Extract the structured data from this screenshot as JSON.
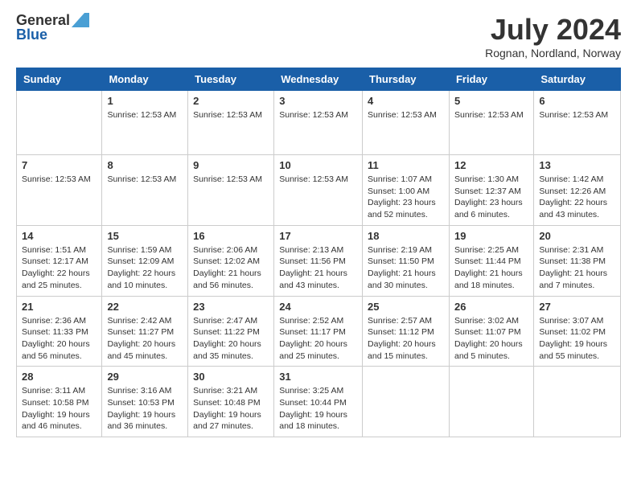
{
  "logo": {
    "general": "General",
    "blue": "Blue"
  },
  "title": "July 2024",
  "subtitle": "Rognan, Nordland, Norway",
  "headers": [
    "Sunday",
    "Monday",
    "Tuesday",
    "Wednesday",
    "Thursday",
    "Friday",
    "Saturday"
  ],
  "weeks": [
    [
      {
        "day": "",
        "info": ""
      },
      {
        "day": "1",
        "info": "Sunrise: 12:53 AM"
      },
      {
        "day": "2",
        "info": "Sunrise: 12:53 AM"
      },
      {
        "day": "3",
        "info": "Sunrise: 12:53 AM"
      },
      {
        "day": "4",
        "info": "Sunrise: 12:53 AM"
      },
      {
        "day": "5",
        "info": "Sunrise: 12:53 AM"
      },
      {
        "day": "6",
        "info": "Sunrise: 12:53 AM"
      }
    ],
    [
      {
        "day": "7",
        "info": "Sunrise: 12:53 AM"
      },
      {
        "day": "8",
        "info": "Sunrise: 12:53 AM"
      },
      {
        "day": "9",
        "info": "Sunrise: 12:53 AM"
      },
      {
        "day": "10",
        "info": "Sunrise: 12:53 AM"
      },
      {
        "day": "11",
        "info": "Sunrise: 1:07 AM\nSunset: 1:00 AM\nDaylight: 23 hours and 52 minutes."
      },
      {
        "day": "12",
        "info": "Sunrise: 1:30 AM\nSunset: 12:37 AM\nDaylight: 23 hours and 6 minutes."
      },
      {
        "day": "13",
        "info": "Sunrise: 1:42 AM\nSunset: 12:26 AM\nDaylight: 22 hours and 43 minutes."
      }
    ],
    [
      {
        "day": "14",
        "info": "Sunrise: 1:51 AM\nSunset: 12:17 AM\nDaylight: 22 hours and 25 minutes."
      },
      {
        "day": "15",
        "info": "Sunrise: 1:59 AM\nSunset: 12:09 AM\nDaylight: 22 hours and 10 minutes."
      },
      {
        "day": "16",
        "info": "Sunrise: 2:06 AM\nSunset: 12:02 AM\nDaylight: 21 hours and 56 minutes."
      },
      {
        "day": "17",
        "info": "Sunrise: 2:13 AM\nSunset: 11:56 PM\nDaylight: 21 hours and 43 minutes."
      },
      {
        "day": "18",
        "info": "Sunrise: 2:19 AM\nSunset: 11:50 PM\nDaylight: 21 hours and 30 minutes."
      },
      {
        "day": "19",
        "info": "Sunrise: 2:25 AM\nSunset: 11:44 PM\nDaylight: 21 hours and 18 minutes."
      },
      {
        "day": "20",
        "info": "Sunrise: 2:31 AM\nSunset: 11:38 PM\nDaylight: 21 hours and 7 minutes."
      }
    ],
    [
      {
        "day": "21",
        "info": "Sunrise: 2:36 AM\nSunset: 11:33 PM\nDaylight: 20 hours and 56 minutes."
      },
      {
        "day": "22",
        "info": "Sunrise: 2:42 AM\nSunset: 11:27 PM\nDaylight: 20 hours and 45 minutes."
      },
      {
        "day": "23",
        "info": "Sunrise: 2:47 AM\nSunset: 11:22 PM\nDaylight: 20 hours and 35 minutes."
      },
      {
        "day": "24",
        "info": "Sunrise: 2:52 AM\nSunset: 11:17 PM\nDaylight: 20 hours and 25 minutes."
      },
      {
        "day": "25",
        "info": "Sunrise: 2:57 AM\nSunset: 11:12 PM\nDaylight: 20 hours and 15 minutes."
      },
      {
        "day": "26",
        "info": "Sunrise: 3:02 AM\nSunset: 11:07 PM\nDaylight: 20 hours and 5 minutes."
      },
      {
        "day": "27",
        "info": "Sunrise: 3:07 AM\nSunset: 11:02 PM\nDaylight: 19 hours and 55 minutes."
      }
    ],
    [
      {
        "day": "28",
        "info": "Sunrise: 3:11 AM\nSunset: 10:58 PM\nDaylight: 19 hours and 46 minutes."
      },
      {
        "day": "29",
        "info": "Sunrise: 3:16 AM\nSunset: 10:53 PM\nDaylight: 19 hours and 36 minutes."
      },
      {
        "day": "30",
        "info": "Sunrise: 3:21 AM\nSunset: 10:48 PM\nDaylight: 19 hours and 27 minutes."
      },
      {
        "day": "31",
        "info": "Sunrise: 3:25 AM\nSunset: 10:44 PM\nDaylight: 19 hours and 18 minutes."
      },
      {
        "day": "",
        "info": ""
      },
      {
        "day": "",
        "info": ""
      },
      {
        "day": "",
        "info": ""
      }
    ]
  ]
}
